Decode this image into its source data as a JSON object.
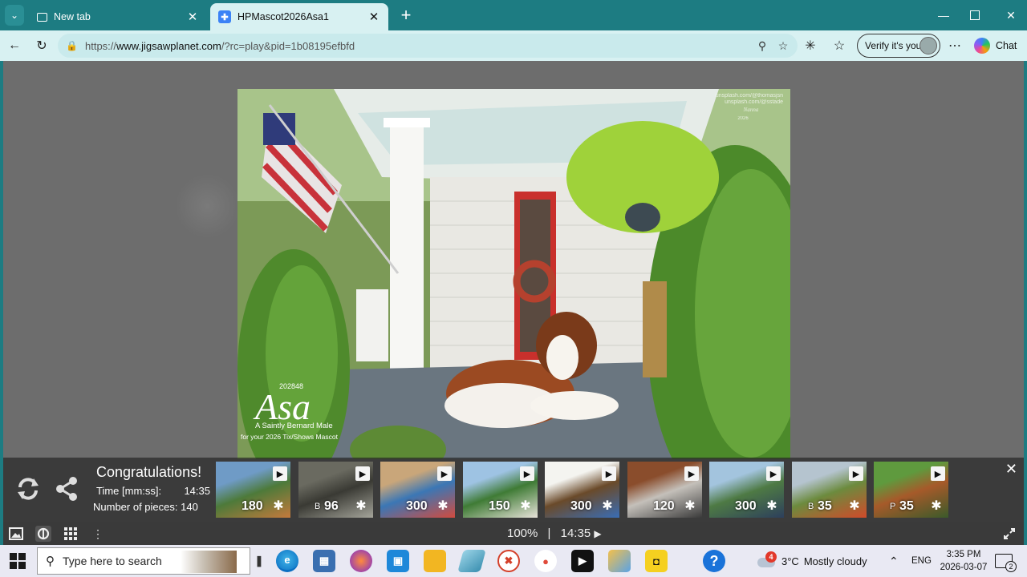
{
  "browser": {
    "tabs": [
      {
        "label": "New tab",
        "active": false
      },
      {
        "label": "HPMascot2026Asa1",
        "active": true
      }
    ],
    "address": {
      "scheme": "https://",
      "host": "www.jigsawplanet.com",
      "rest": "/?rc=play&pid=1b08195efbfd"
    },
    "verify_label": "Verify it's you",
    "chat_label": "Chat"
  },
  "puzzle": {
    "photo_credit_1": "unsplash.com/@thomasjsn",
    "photo_credit_2": "unsplash.com/@sstade",
    "signature": "Nanna",
    "signature_year": "2026",
    "name_number": "202848",
    "name": "Asa",
    "subtitle_1": "A Saintly Bernard Male",
    "subtitle_2": "for your 2026 Tix/Shows Mascot"
  },
  "congrats": {
    "title": "Congratulations!",
    "time_label": "Time [mm:ss]:",
    "time_value": "14:35",
    "pieces_label": "Number of pieces:",
    "pieces_value": "140"
  },
  "thumbnails": [
    {
      "count": "180",
      "letter": "",
      "colors": [
        "#6f9bc6",
        "#4d7a3a",
        "#c47a3c"
      ]
    },
    {
      "count": "96",
      "letter": "B",
      "colors": [
        "#6a6a60",
        "#3a3a34",
        "#a4a49a"
      ]
    },
    {
      "count": "300",
      "letter": "",
      "colors": [
        "#c9a67a",
        "#3b77b5",
        "#d24b3f"
      ]
    },
    {
      "count": "150",
      "letter": "",
      "colors": [
        "#9ec3e3",
        "#3f7b35",
        "#e8e3da"
      ]
    },
    {
      "count": "300",
      "letter": "",
      "colors": [
        "#f4f4f0",
        "#6a4a2a",
        "#3a6db5"
      ]
    },
    {
      "count": "120",
      "letter": "",
      "colors": [
        "#8a4d2c",
        "#c4c0ba",
        "#3a3a3a"
      ]
    },
    {
      "count": "300",
      "letter": "",
      "colors": [
        "#a3c4de",
        "#4e7a44",
        "#2d3f5c"
      ]
    },
    {
      "count": "35",
      "letter": "B",
      "colors": [
        "#b5c4cf",
        "#6c8b3e",
        "#d14a2a"
      ]
    },
    {
      "count": "35",
      "letter": "P",
      "colors": [
        "#5f9a3e",
        "#a65a2a",
        "#3b5a2a"
      ]
    }
  ],
  "controls": {
    "zoom": "100%",
    "separator": "|",
    "timer": "14:35"
  },
  "taskbar": {
    "search_placeholder": "Type here to search",
    "weather_badge": "4",
    "temperature": "3°C",
    "condition": "Mostly cloudy",
    "language": "ENG",
    "time": "3:35 PM",
    "date": "2026-03-07",
    "notifications": "2"
  }
}
